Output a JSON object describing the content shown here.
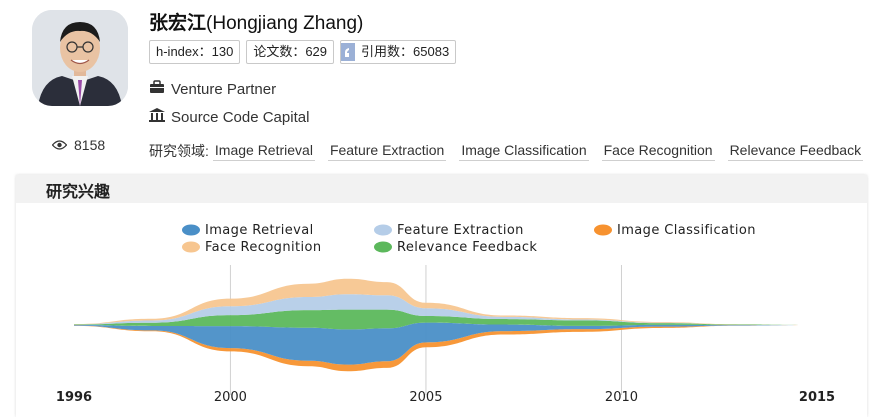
{
  "profile": {
    "name_cn": "张宏江",
    "name_en": "(Hongjiang Zhang)",
    "stats": {
      "h_index": "h-index：130",
      "papers": "论文数：629",
      "citations": "引用数：65083"
    },
    "position": "Venture Partner",
    "organization": "Source Code Capital",
    "views": "8158",
    "tags_label": "研究领域:",
    "tags": [
      "Image Retrieval",
      "Feature Extraction",
      "Image Classification",
      "Face Recognition",
      "Relevance Feedback"
    ]
  },
  "panel": {
    "title": "研究兴趣"
  },
  "chart_data": {
    "type": "area",
    "x": [
      1996,
      1998,
      2000,
      2002,
      2003,
      2004,
      2005,
      2007,
      2009,
      2011,
      2013,
      2015
    ],
    "x_ticks": [
      "1996",
      "2000",
      "2005",
      "2010",
      "2015"
    ],
    "series": [
      {
        "name": "Image Retrieval",
        "color": "#4a8fc7",
        "values": [
          0.3,
          2,
          10,
          15,
          16,
          15,
          9,
          3,
          1.5,
          0.8,
          0.2,
          0
        ]
      },
      {
        "name": "Feature Extraction",
        "color": "#b5cde8",
        "values": [
          0.1,
          1,
          4,
          6,
          7,
          6.5,
          3.5,
          1,
          0.4,
          0.2,
          0,
          0
        ]
      },
      {
        "name": "Image Classification",
        "color": "#f7922f",
        "values": [
          0.1,
          0.4,
          1.5,
          2.5,
          3,
          3,
          2.2,
          1.5,
          1.2,
          0.6,
          0.1,
          0
        ]
      },
      {
        "name": "Face Recognition",
        "color": "#f7c690",
        "values": [
          0.1,
          0.8,
          3.5,
          6,
          7,
          6,
          2.5,
          0.6,
          0.6,
          0.3,
          0.1,
          0
        ]
      },
      {
        "name": "Relevance Feedback",
        "color": "#5cb85c",
        "values": [
          0.2,
          1.5,
          5,
          8,
          9,
          8.5,
          3,
          2.5,
          2.5,
          0.8,
          0.2,
          0
        ]
      }
    ],
    "legend": [
      [
        "Image Retrieval",
        "Feature Extraction",
        "Image Classification"
      ],
      [
        "Face Recognition",
        "Relevance Feedback"
      ]
    ],
    "grid": true,
    "legend_position": "top"
  }
}
